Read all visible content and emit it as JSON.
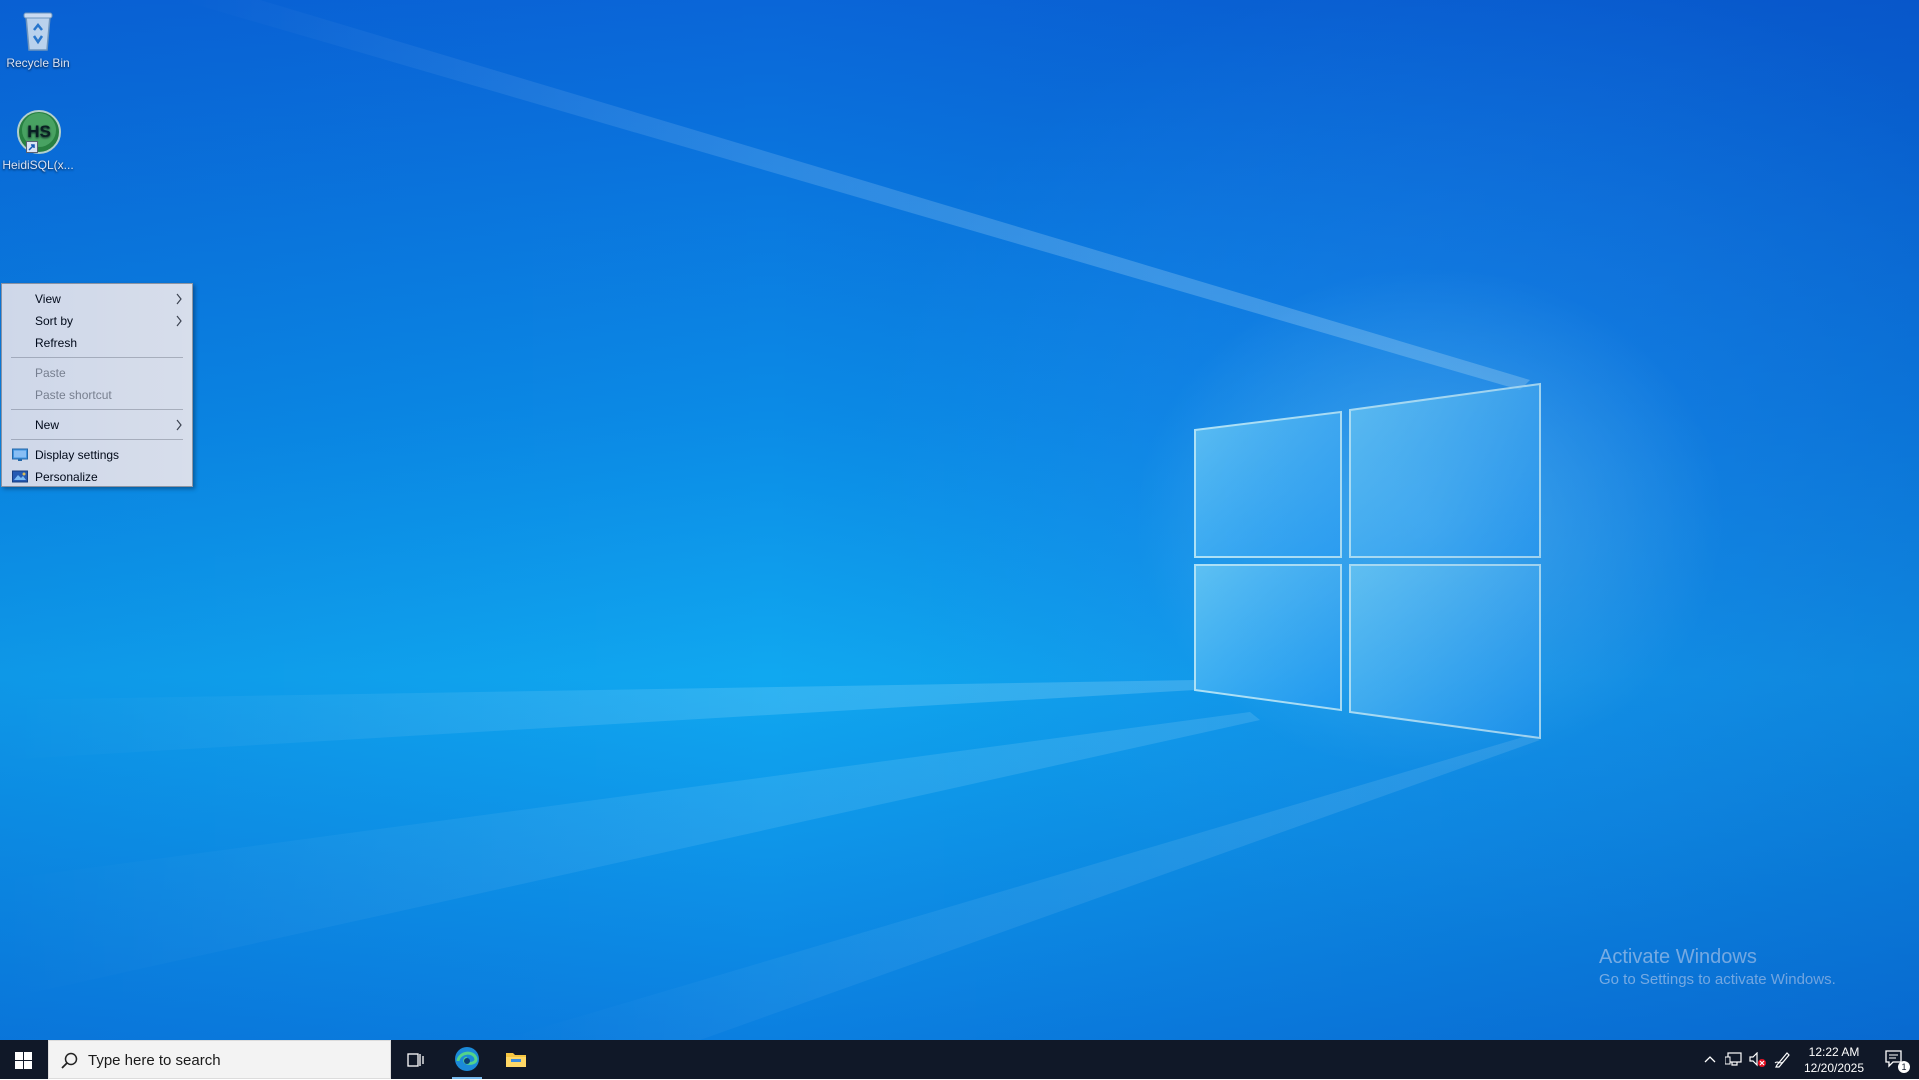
{
  "desktop": {
    "icons": [
      {
        "label": "Recycle Bin",
        "icon": "recycle-bin-icon"
      },
      {
        "label": "HeidiSQL(x...",
        "icon": "heidisql-icon",
        "badge": "HS"
      }
    ],
    "watermark": {
      "title": "Activate Windows",
      "subtitle": "Go to Settings to activate Windows."
    }
  },
  "context_menu": {
    "items": [
      {
        "label": "View",
        "submenu": true,
        "enabled": true
      },
      {
        "label": "Sort by",
        "submenu": true,
        "enabled": true
      },
      {
        "label": "Refresh",
        "submenu": false,
        "enabled": true
      },
      {
        "label": "Paste",
        "submenu": false,
        "enabled": false
      },
      {
        "label": "Paste shortcut",
        "submenu": false,
        "enabled": false
      },
      {
        "label": "New",
        "submenu": true,
        "enabled": true
      },
      {
        "label": "Display settings",
        "submenu": false,
        "enabled": true,
        "icon": "display-settings-icon"
      },
      {
        "label": "Personalize",
        "submenu": false,
        "enabled": true,
        "icon": "personalize-icon"
      }
    ]
  },
  "taskbar": {
    "search_placeholder": "Type here to search",
    "pinned": [
      "task-view-icon",
      "edge-icon",
      "file-explorer-icon"
    ],
    "tray_icons": [
      "chevron-up-icon",
      "network-icon",
      "volume-muted-icon",
      "pen-icon"
    ],
    "clock": {
      "time": "12:22 AM",
      "date": "12/20/2025"
    },
    "notifications": {
      "count": "1"
    }
  },
  "colors": {
    "taskbar_bg": "#101828",
    "menu_bg": "#f2f2f2",
    "accent": "#0078d7"
  }
}
